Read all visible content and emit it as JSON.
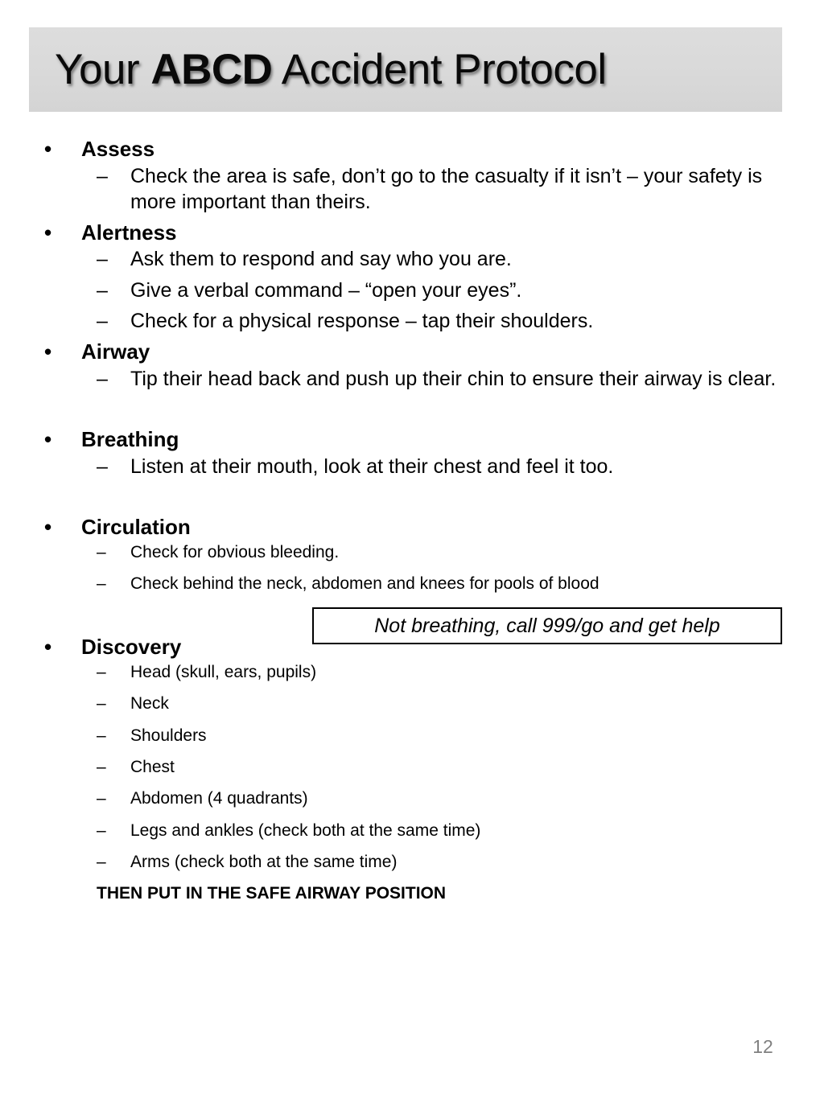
{
  "title": {
    "prefix": "Your ",
    "emphasis": "ABCD",
    "suffix": " Accident Protocol",
    "band_color": "#d9d9d9"
  },
  "bullets": {
    "marker": "•",
    "dash": "–"
  },
  "sections": [
    {
      "heading": "Assess",
      "size": "large",
      "items": [
        "Check the area is safe, don’t go to the casualty if it isn’t – your safety is more important than theirs."
      ]
    },
    {
      "heading": "Alertness",
      "size": "large",
      "items": [
        "Ask them to respond and say who you are.",
        "Give a verbal command – “open your eyes”.",
        "Check for a physical response – tap their shoulders."
      ]
    },
    {
      "heading": "Airway",
      "size": "large",
      "items": [
        "Tip their head back and push up their chin to ensure their airway is clear."
      ]
    },
    {
      "heading": "Breathing",
      "size": "large",
      "items": [
        "Listen at their mouth, look at their chest and feel it too."
      ]
    },
    {
      "heading": "Circulation",
      "size": "small",
      "items": [
        "Check for obvious bleeding.",
        "Check behind the neck, abdomen and knees for pools of blood"
      ]
    },
    {
      "heading": "Discovery",
      "size": "small",
      "items": [
        "Head (skull, ears, pupils)",
        "Neck",
        "Shoulders",
        "Chest",
        "Abdomen (4 quadrants)",
        "Legs and ankles (check both at the same time)",
        "Arms (check both at the same time)"
      ]
    }
  ],
  "closing_line": "THEN PUT IN THE SAFE AIRWAY POSITION",
  "callout": {
    "text": "Not breathing, call 999/go and get help"
  },
  "page_number": "12"
}
